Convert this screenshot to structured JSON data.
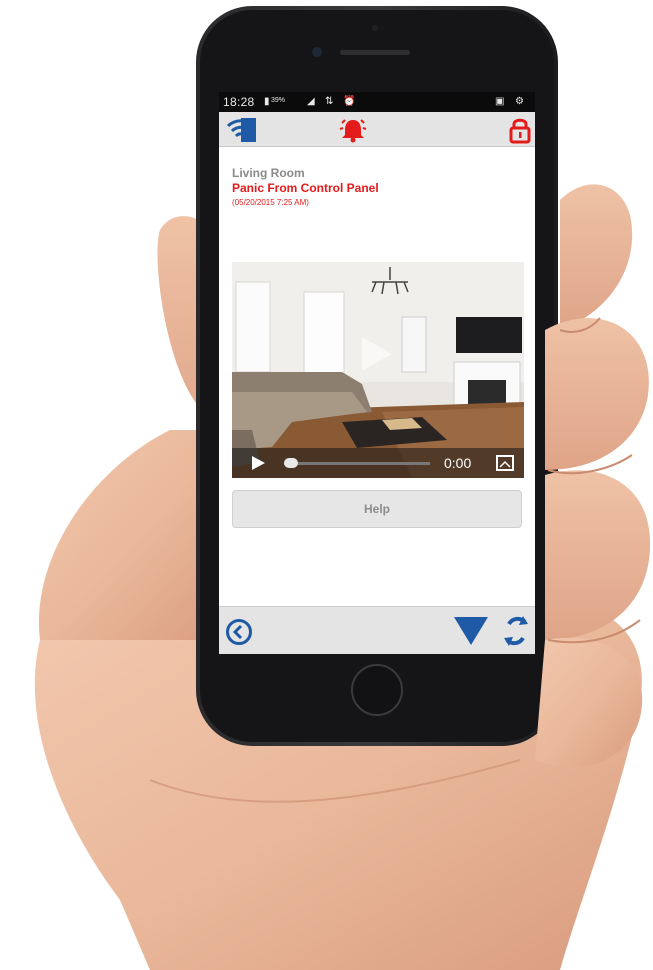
{
  "status_bar": {
    "time": "18:28",
    "battery": "39%"
  },
  "app_header": {
    "logo_icon": "wifi-logo-icon",
    "alarm_icon": "alarm-bell-icon",
    "lock_icon": "lock-icon"
  },
  "alarm": {
    "location": "Living Room",
    "event": "Panic From Control Panel",
    "timestamp": "(05/20/2015 7:25 AM)"
  },
  "video": {
    "time": "0:00",
    "progress": 0.0,
    "icons": [
      "play-icon",
      "fullscreen-icon"
    ]
  },
  "help_button": {
    "label": "Help"
  },
  "bottom_bar": {
    "icons": [
      "back-icon",
      "dropdown-triangle-icon",
      "refresh-icon"
    ]
  },
  "colors": {
    "brand_blue": "#1f5aa6",
    "alert_red": "#e31b1b",
    "bar_gray": "#e4e4e4"
  }
}
